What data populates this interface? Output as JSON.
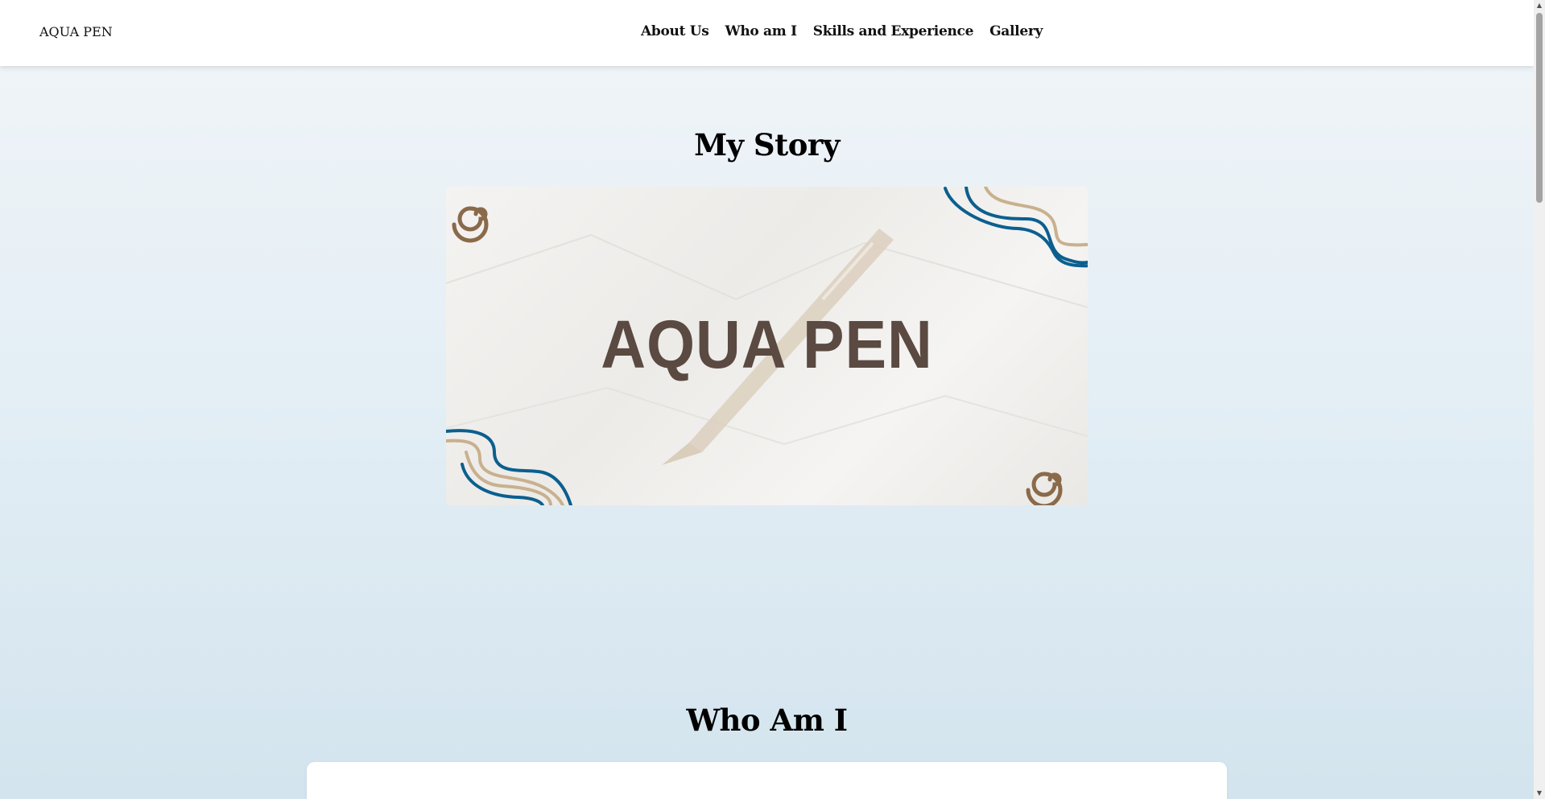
{
  "header": {
    "brand": "AQUA PEN",
    "nav": [
      "About Us",
      "Who am I",
      "Skills and Experience",
      "Gallery"
    ]
  },
  "story": {
    "title": "My Story",
    "banner_text": "AQUA PEN"
  },
  "who": {
    "title": "Who Am I"
  },
  "colors": {
    "banner_text": "#5b4a42",
    "swirl_brown": "#8a6a4a",
    "wave_blue": "#0b5f8f",
    "wave_tan": "#c9b08e"
  }
}
